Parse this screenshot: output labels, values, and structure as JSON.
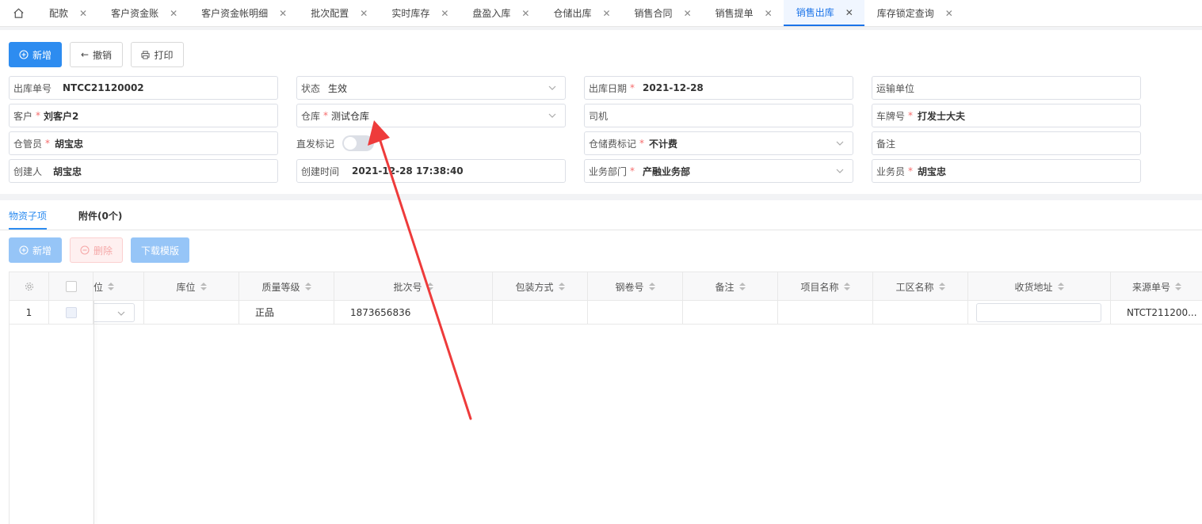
{
  "tabs": [
    {
      "label": "配款",
      "active": false
    },
    {
      "label": "客户资金账",
      "active": false
    },
    {
      "label": "客户资金帐明细",
      "active": false
    },
    {
      "label": "批次配置",
      "active": false
    },
    {
      "label": "实时库存",
      "active": false
    },
    {
      "label": "盘盈入库",
      "active": false
    },
    {
      "label": "仓储出库",
      "active": false
    },
    {
      "label": "销售合同",
      "active": false
    },
    {
      "label": "销售提单",
      "active": false
    },
    {
      "label": "销售出库",
      "active": true
    },
    {
      "label": "库存锁定查询",
      "active": false
    }
  ],
  "toolbar": {
    "add": "新增",
    "revoke": "撤销",
    "print": "打印"
  },
  "form": {
    "out_no_label": "出库单号",
    "out_no": "NTCC21120002",
    "status_label": "状态",
    "status": "生效",
    "out_date_label": "出库日期",
    "out_date": "2021-12-28",
    "transport_label": "运输单位",
    "customer_label": "客户",
    "customer": "刘客户2",
    "warehouse_label": "仓库",
    "warehouse": "测试仓库",
    "driver_label": "司机",
    "plate_label": "车牌号",
    "plate": "打发士大夫",
    "keeper_label": "仓管员",
    "keeper": "胡宝忠",
    "direct_label": "直发标记",
    "storage_fee_label": "仓储费标记",
    "storage_fee": "不计费",
    "remark_label": "备注",
    "creator_label": "创建人",
    "creator": "胡宝忠",
    "created_label": "创建时间",
    "created": "2021-12-28 17:38:40",
    "dept_label": "业务部门",
    "dept": "产融业务部",
    "salesman_label": "业务员",
    "salesman": "胡宝忠"
  },
  "subtabs": {
    "items": "物资子项",
    "attachments": "附件(0个)"
  },
  "subtoolbar": {
    "add": "新增",
    "delete": "删除",
    "download": "下载模版"
  },
  "table": {
    "columns": [
      "单位",
      "库位",
      "质量等级",
      "批次号",
      "包装方式",
      "钢卷号",
      "备注",
      "项目名称",
      "工区名称",
      "收货地址",
      "来源单号"
    ],
    "rows": [
      {
        "index": "1",
        "quality": "正品",
        "batch": "1873656836",
        "source": "NTCT211200..."
      }
    ]
  },
  "colors": {
    "primary": "#2d8cf0",
    "arrow": "#ee3b3b"
  }
}
